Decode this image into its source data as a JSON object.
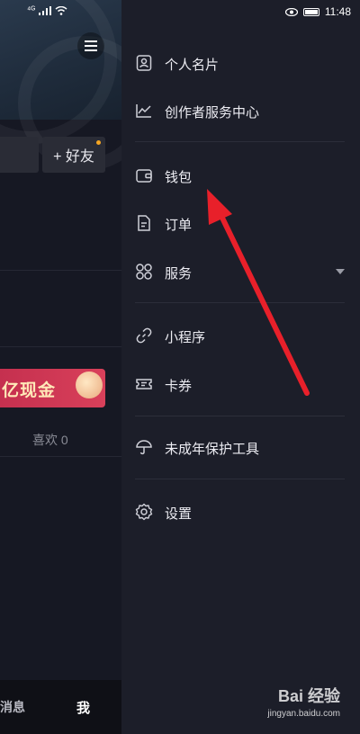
{
  "status_bar": {
    "left_signal": "⁴ᴳ",
    "time": "11:48"
  },
  "profile_page": {
    "add_friend": "+ 好友",
    "banner_text": "亿现金",
    "likes": "喜欢 0",
    "tabs": {
      "messages": "消息",
      "me": "我"
    }
  },
  "drawer": {
    "items": [
      {
        "label": "个人名片",
        "icon": "profile-card-icon"
      },
      {
        "label": "创作者服务中心",
        "icon": "chart-line-icon"
      },
      {
        "label": "钱包",
        "icon": "wallet-icon"
      },
      {
        "label": "订单",
        "icon": "order-icon"
      },
      {
        "label": "服务",
        "icon": "grid-icon",
        "expandable": true
      },
      {
        "label": "小程序",
        "icon": "link-icon"
      },
      {
        "label": "卡券",
        "icon": "ticket-icon"
      },
      {
        "label": "未成年保护工具",
        "icon": "umbrella-icon"
      },
      {
        "label": "设置",
        "icon": "gear-icon"
      }
    ]
  },
  "annotation": {
    "arrow_color": "#e8202a",
    "points_to": "钱包"
  },
  "watermark": {
    "brand": "Bai 经验",
    "url": "jingyan.baidu.com"
  },
  "colors": {
    "drawer_bg": "#1c1e29",
    "page_bg": "#161823",
    "banner": "#d03a55"
  }
}
